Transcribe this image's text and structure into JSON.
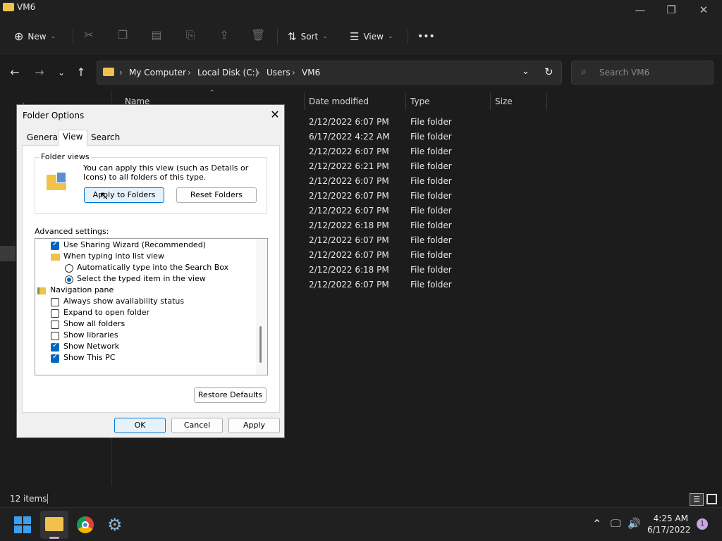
{
  "window": {
    "title": "VM6"
  },
  "toolbar": {
    "new_label": "New",
    "sort_label": "Sort",
    "view_label": "View",
    "more_label": "•••"
  },
  "address": {
    "crumbs": [
      "My Computer",
      "Local Disk (C:)",
      "Users",
      "VM6"
    ],
    "search_placeholder": "Search VM6"
  },
  "columns": {
    "name": "Name",
    "date": "Date modified",
    "type": "Type",
    "size": "Size"
  },
  "rows": [
    {
      "date": "2/12/2022 6:07 PM",
      "type": "File folder"
    },
    {
      "date": "6/17/2022 4:22 AM",
      "type": "File folder"
    },
    {
      "date": "2/12/2022 6:07 PM",
      "type": "File folder"
    },
    {
      "date": "2/12/2022 6:21 PM",
      "type": "File folder"
    },
    {
      "date": "2/12/2022 6:07 PM",
      "type": "File folder"
    },
    {
      "date": "2/12/2022 6:07 PM",
      "type": "File folder"
    },
    {
      "date": "2/12/2022 6:07 PM",
      "type": "File folder"
    },
    {
      "date": "2/12/2022 6:18 PM",
      "type": "File folder"
    },
    {
      "date": "2/12/2022 6:07 PM",
      "type": "File folder"
    },
    {
      "date": "2/12/2022 6:07 PM",
      "type": "File folder"
    },
    {
      "date": "2/12/2022 6:18 PM",
      "type": "File folder"
    },
    {
      "date": "2/12/2022 6:07 PM",
      "type": "File folder"
    }
  ],
  "status": {
    "items": "12 items"
  },
  "dialog": {
    "title": "Folder Options",
    "tabs": [
      "General",
      "View",
      "Search"
    ],
    "active_tab": "View",
    "folder_views_label": "Folder views",
    "folder_views_text": "You can apply this view (such as Details or Icons) to all folders of this type.",
    "apply_to_folders": "Apply to Folders",
    "reset_folders": "Reset Folders",
    "advanced_label": "Advanced settings:",
    "options": [
      {
        "kind": "checkbox",
        "checked": true,
        "label": "Use Sharing Wizard (Recommended)"
      },
      {
        "kind": "folder",
        "label": "When typing into list view"
      },
      {
        "kind": "radio",
        "checked": false,
        "label": "Automatically type into the Search Box"
      },
      {
        "kind": "radio",
        "checked": true,
        "label": "Select the typed item in the view"
      },
      {
        "kind": "nav",
        "label": "Navigation pane"
      },
      {
        "kind": "checkbox",
        "checked": false,
        "label": "Always show availability status"
      },
      {
        "kind": "checkbox",
        "checked": false,
        "label": "Expand to open folder"
      },
      {
        "kind": "checkbox",
        "checked": false,
        "label": "Show all folders"
      },
      {
        "kind": "checkbox",
        "checked": false,
        "label": "Show libraries"
      },
      {
        "kind": "checkbox",
        "checked": true,
        "label": "Show Network"
      },
      {
        "kind": "checkbox",
        "checked": true,
        "label": "Show This PC"
      }
    ],
    "restore_defaults": "Restore Defaults",
    "ok": "OK",
    "cancel": "Cancel",
    "apply": "Apply"
  },
  "taskbar": {
    "time": "4:25 AM",
    "date": "6/17/2022",
    "notification_count": "1"
  },
  "colors": {
    "accent": "#0067c0",
    "folder": "#f0c24b",
    "dark_bg": "#1c1c1c"
  }
}
